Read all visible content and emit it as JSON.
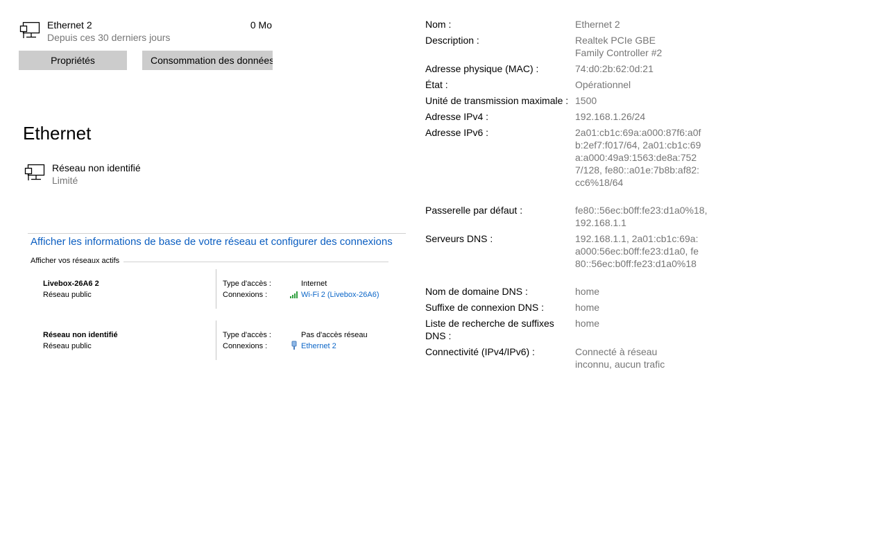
{
  "adapter": {
    "name": "Ethernet 2",
    "period": "Depuis ces 30 derniers jours",
    "usage": "0 Mo",
    "properties_button": "Propriétés",
    "usage_button": "Consommation des données"
  },
  "ethernet_section": {
    "title": "Ethernet",
    "network_name": "Réseau non identifié",
    "network_status": "Limité"
  },
  "control_panel": {
    "link": "Afficher les informations de base de votre réseau et configurer des connexions",
    "active_header": "Afficher vos réseaux actifs",
    "networks": [
      {
        "name": "Livebox-26A6 2",
        "type": "Réseau public",
        "access_label": "Type d'accès :",
        "access_value": "Internet",
        "conn_label": "Connexions :",
        "conn_value": "Wi-Fi 2 (Livebox-26A6)"
      },
      {
        "name": "Réseau non identifié",
        "type": "Réseau public",
        "access_label": "Type d'accès :",
        "access_value": "Pas d'accès réseau",
        "conn_label": "Connexions :",
        "conn_value": "Ethernet 2"
      }
    ]
  },
  "properties": [
    {
      "label": "Nom :",
      "value": "Ethernet 2"
    },
    {
      "label": "Description :",
      "value": "Realtek PCIe GBE Family Controller #2"
    },
    {
      "label": "Adresse physique (MAC) :",
      "value": "74:d0:2b:62:0d:21"
    },
    {
      "label": "État :",
      "value": "Opérationnel"
    },
    {
      "label": "Unité de transmission maximale :",
      "value": "1500"
    },
    {
      "label": "Adresse IPv4 :",
      "value": "192.168.1.26/24"
    },
    {
      "label": "Adresse IPv6 :",
      "value": "2a01:cb1c:69a:a000:87f6:a0fb:2ef7:f017/64, 2a01:cb1c:69a:a000:49a9:1563:de8a:7527/128, fe80::a01e:7b8b:af82:cc6%18/64"
    },
    {
      "label": "Passerelle par défaut :",
      "value": "fe80::56ec:b0ff:fe23:d1a0%18, 192.168.1.1"
    },
    {
      "label": "Serveurs DNS :",
      "value": "192.168.1.1, 2a01:cb1c:69a:a000:56ec:b0ff:fe23:d1a0, fe80::56ec:b0ff:fe23:d1a0%18"
    },
    {
      "label": "Nom de domaine DNS :",
      "value": "home"
    },
    {
      "label": "Suffixe de connexion DNS :",
      "value": "home"
    },
    {
      "label": "Liste de recherche de suffixes DNS :",
      "value": "home"
    },
    {
      "label": "Connectivité (IPv4/IPv6) :",
      "value": "Connecté à réseau inconnu, aucun trafic"
    }
  ],
  "colors": {
    "link": "#0b5ec1",
    "secondary_text": "#767676",
    "button_bg": "#cccccc"
  }
}
